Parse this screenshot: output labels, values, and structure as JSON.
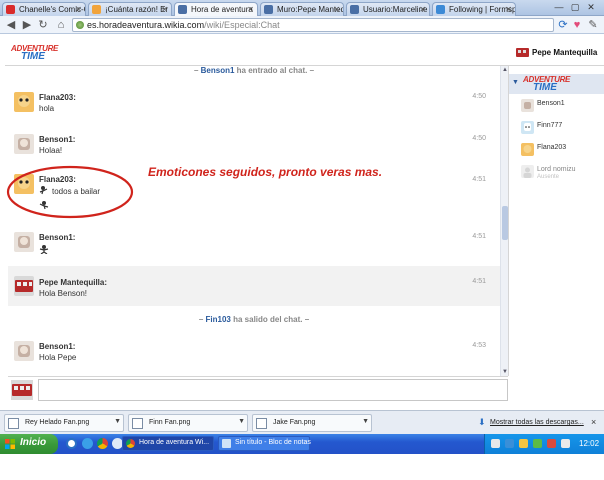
{
  "browser": {
    "tabs": [
      {
        "label": "Chanelle's Comic-C",
        "favicon_color": "#d92b2b",
        "active": false
      },
      {
        "label": "¡Cuánta razón! Er",
        "favicon_color": "#f1a43c",
        "active": false
      },
      {
        "label": "Hora de aventura",
        "favicon_color": "#4a6fa5",
        "active": true
      },
      {
        "label": "Muro:Pepe Mantequ",
        "favicon_color": "#4a6fa5",
        "active": false
      },
      {
        "label": "Usuario:Marceline",
        "favicon_color": "#4a6fa5",
        "active": false
      },
      {
        "label": "Following | Formsp",
        "favicon_color": "#3c8ad6",
        "active": false
      }
    ],
    "url_host": "es.horadeaventura.wikia.com",
    "url_path": "/wiki/Especial:Chat"
  },
  "chat": {
    "logo": {
      "line1": "ADVENTURE",
      "line2": "TIME"
    },
    "header_user": "Pepe Mantequilla",
    "alerts": [
      {
        "user": "Benson1",
        "text": "ha entrado al chat."
      },
      {
        "user": "Fin103",
        "text": "ha salido del chat."
      }
    ],
    "messages": [
      {
        "user": "Flana203:",
        "text": "hola",
        "time": "4:50"
      },
      {
        "user": "Benson1:",
        "text": "Holaa!",
        "time": "4:50"
      },
      {
        "user": "Flana203:",
        "text": "todos a bailar",
        "time": "4:51"
      },
      {
        "user": "Benson1:",
        "text": "",
        "time": "4:51"
      },
      {
        "user": "Pepe Mantequilla:",
        "text": "Hola Benson!",
        "time": "4:51"
      },
      {
        "user": "Benson1:",
        "text": "Hola Pepe",
        "time": "4:53"
      }
    ],
    "annotation": "Emoticones seguidos, pronto veras mas.",
    "userlist": [
      {
        "name": "Benson1",
        "status": ""
      },
      {
        "name": "Finn777",
        "status": ""
      },
      {
        "name": "Flana203",
        "status": ""
      },
      {
        "name": "Lord nomizu",
        "status": "Ausente"
      }
    ],
    "input_value": ""
  },
  "downloads": {
    "files": [
      "Rey Helado Fan.png",
      "Finn Fan.png",
      "Jake Fan.png"
    ],
    "show_all": "Mostrar todas las descargas...",
    "close": "×"
  },
  "taskbar": {
    "start_label": "Inicio",
    "tasks": [
      "Hora de aventura Wi...",
      "Sin título - Bloc de notas"
    ],
    "clock": "12:02"
  },
  "colors": {
    "accent_red": "#d0241c",
    "link_blue": "#2a5a9c",
    "xp_blue": "#2458cf",
    "xp_green": "#3a9a3b"
  }
}
